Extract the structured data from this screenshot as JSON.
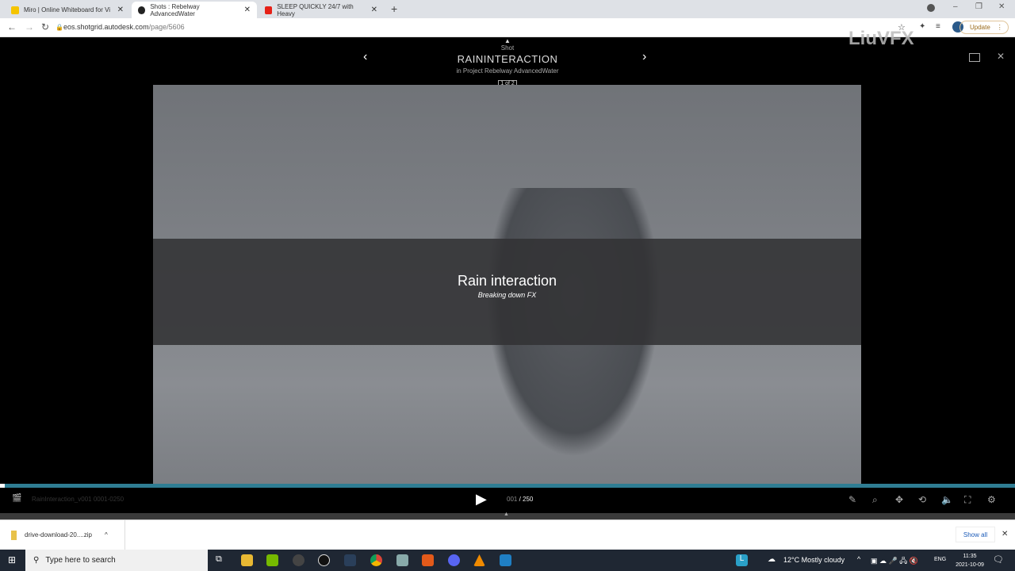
{
  "browser": {
    "tabs": [
      {
        "label": "Miro | Online Whiteboard for Vi",
        "color": "#f5c400"
      },
      {
        "label": "Shots : Rebelway AdvancedWater",
        "color": "#222"
      },
      {
        "label": "SLEEP QUICKLY 24/7 with Heavy",
        "color": "#e62117"
      }
    ],
    "new_tab": "+",
    "url_domain": "eos.shotgrid.autodesk.com",
    "url_path": "/page/5606",
    "update_label": "Update"
  },
  "watermark": "LiuVFX",
  "viewer": {
    "entity_type": "Shot",
    "title": "RAININTERACTION",
    "subtitle": "in Project Rebelway AdvancedWater",
    "pager": "1 of 2",
    "overlay_title": "Rain interaction",
    "overlay_subtitle": "Breaking down FX",
    "clip_name": "RainInteraction_v001 0001-0250",
    "frame_current": "001",
    "frame_total": "250",
    "progress": 0.004
  },
  "downloads": {
    "file": "drive-download-20....zip",
    "show_all": "Show all"
  },
  "taskbar": {
    "search_placeholder": "Type here to search",
    "weather": "12°C  Mostly cloudy",
    "lang": "ENG",
    "time": "11:35",
    "date": "2021-10-09"
  }
}
